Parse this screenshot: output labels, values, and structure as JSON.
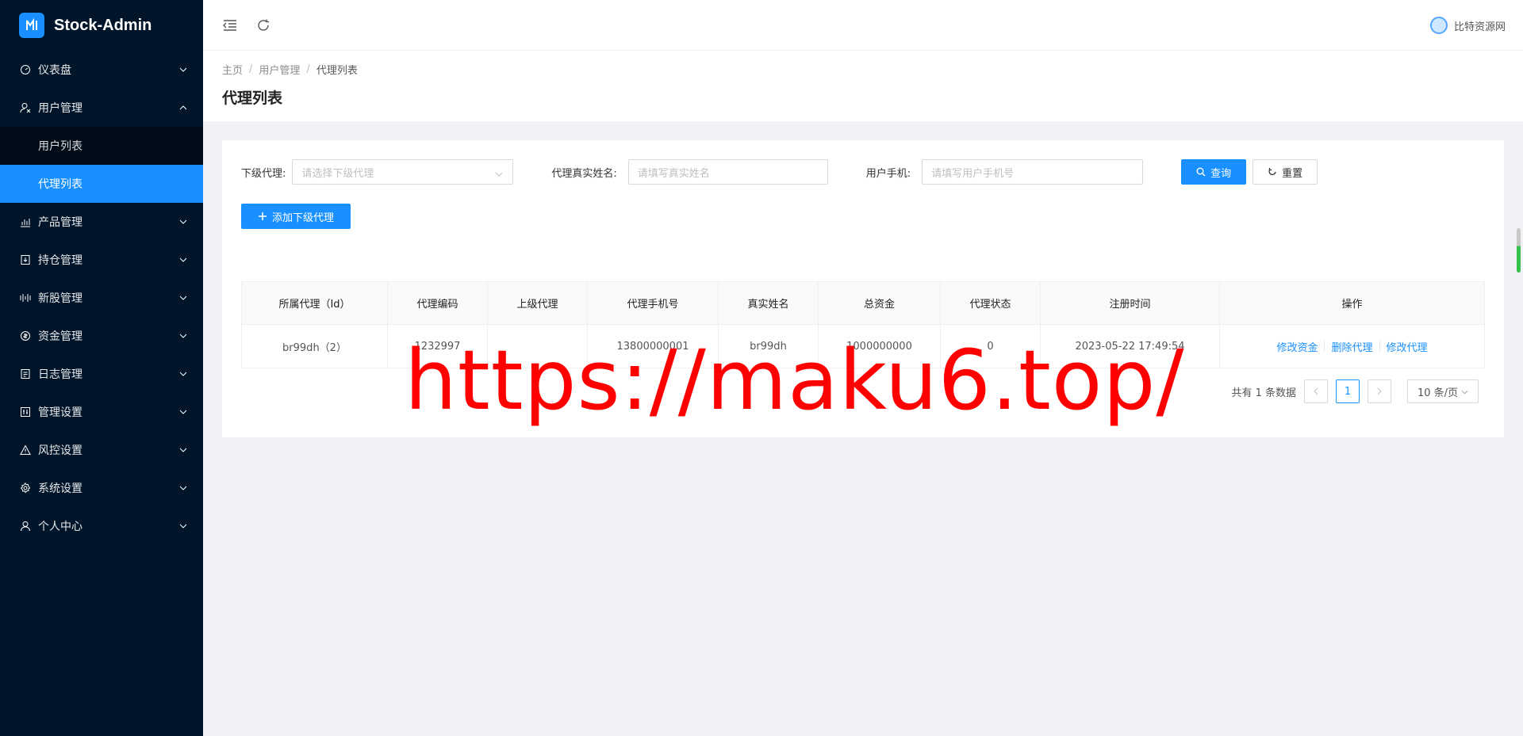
{
  "app": {
    "title": "Stock-Admin"
  },
  "sidebar": {
    "items": [
      {
        "label": "仪表盘",
        "icon": "dashboard-icon"
      },
      {
        "label": "用户管理",
        "icon": "user-manage-icon",
        "expanded": true,
        "children": [
          {
            "label": "用户列表"
          },
          {
            "label": "代理列表",
            "active": true
          }
        ]
      },
      {
        "label": "产品管理",
        "icon": "chart-icon"
      },
      {
        "label": "持仓管理",
        "icon": "position-icon"
      },
      {
        "label": "新股管理",
        "icon": "ipo-icon"
      },
      {
        "label": "资金管理",
        "icon": "money-icon"
      },
      {
        "label": "日志管理",
        "icon": "log-icon"
      },
      {
        "label": "管理设置",
        "icon": "admin-settings-icon"
      },
      {
        "label": "风控设置",
        "icon": "warning-icon"
      },
      {
        "label": "系统设置",
        "icon": "gear-icon"
      },
      {
        "label": "个人中心",
        "icon": "person-icon"
      }
    ]
  },
  "header": {
    "user": "比特资源网"
  },
  "breadcrumb": {
    "home": "主页",
    "parent": "用户管理",
    "current": "代理列表"
  },
  "page_title": "代理列表",
  "filters": {
    "sub_agent_label": "下级代理:",
    "sub_agent_placeholder": "请选择下级代理",
    "real_name_label": "代理真实姓名:",
    "real_name_placeholder": "请填写真实姓名",
    "phone_label": "用户手机:",
    "phone_placeholder": "请填写用户手机号",
    "search": "查询",
    "reset": "重置"
  },
  "add_button": "添加下级代理",
  "table": {
    "columns": [
      "所属代理（Id）",
      "代理编码",
      "上级代理",
      "代理手机号",
      "真实姓名",
      "总资金",
      "代理状态",
      "注册时间",
      "操作"
    ],
    "rows": [
      {
        "owner": "br99dh（2）",
        "code": "1232997",
        "parent": "",
        "phone": "13800000001",
        "name": "br99dh",
        "funds": "1000000000",
        "status": "0",
        "registered": "2023-05-22 17:49:54",
        "ops": [
          "修改资金",
          "删除代理",
          "修改代理"
        ]
      }
    ]
  },
  "pagination": {
    "total_text": "共有 1 条数据",
    "current_page": "1",
    "page_size": "10 条/页"
  },
  "watermark": "https://maku6.top/",
  "colors": {
    "sidebar_bg": "#001529",
    "primary": "#1890ff",
    "watermark": "#ff0000"
  }
}
